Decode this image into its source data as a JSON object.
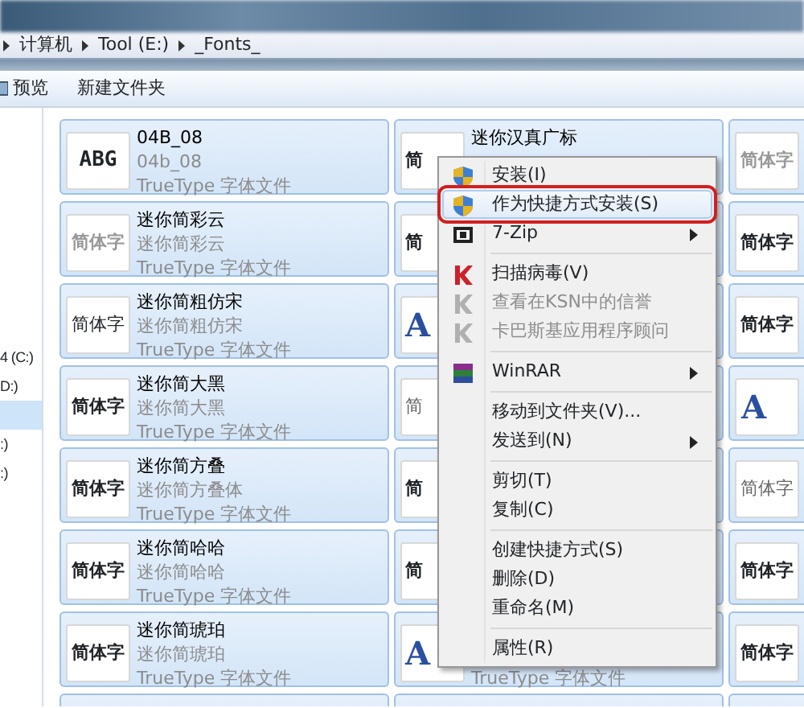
{
  "address_bar": {
    "crumbs": [
      "计算机",
      "Tool (E:)",
      "_Fonts_"
    ]
  },
  "toolbar": {
    "buttons": [
      {
        "label": "预览",
        "kind": "preview"
      },
      {
        "label": "新建文件夹",
        "kind": "plain"
      }
    ]
  },
  "nav_pane": {
    "items": [
      {
        "label": "4 (C:)",
        "selected": false
      },
      {
        "label": "D:)",
        "selected": false
      },
      {
        "selected": true
      },
      {
        "label": ":)",
        "selected": false
      },
      {
        "label": ":)",
        "selected": false
      }
    ]
  },
  "tiles": [
    {
      "selected": true,
      "preview": "ABG",
      "kind": "pixel",
      "name": "04B_08",
      "font": "04b_08",
      "type": "TrueType 字体文件"
    },
    {
      "selected": true,
      "preview": "简",
      "kind": "bold",
      "name": "迷你汉真广标"
    },
    {
      "selected": true,
      "preview": "简体字",
      "kind": "outline"
    },
    {
      "selected": true,
      "preview": "简体字",
      "kind": "outline",
      "name": "迷你简彩云",
      "font": "迷你简彩云",
      "type": "TrueType 字体文件"
    },
    {
      "selected": true,
      "preview": "简",
      "kind": "bold"
    },
    {
      "selected": true,
      "preview": "简体字",
      "kind": "bold"
    },
    {
      "selected": true,
      "preview": "简体字",
      "kind": "regular",
      "name": "迷你简粗仿宋",
      "font": "迷你简粗仿宋",
      "type": "TrueType 字体文件"
    },
    {
      "selected": true,
      "preview": "A",
      "kind": "serif"
    },
    {
      "selected": true,
      "preview": "简体字",
      "kind": "bold"
    },
    {
      "selected": true,
      "preview": "简体字",
      "kind": "bold",
      "name": "迷你简大黑",
      "font": "迷你简大黑",
      "type": "TrueType 字体文件"
    },
    {
      "selected": true,
      "preview": "简",
      "kind": "light"
    },
    {
      "selected": true,
      "preview": "A",
      "kind": "serif"
    },
    {
      "selected": true,
      "preview": "简体字",
      "kind": "bold",
      "name": "迷你简方叠",
      "font": "迷你简方叠体",
      "type": "TrueType 字体文件"
    },
    {
      "selected": true,
      "preview": "简",
      "kind": "bold"
    },
    {
      "selected": true,
      "preview": "简体字",
      "kind": "light"
    },
    {
      "selected": true,
      "preview": "简体字",
      "kind": "bold",
      "name": "迷你简哈哈",
      "font": "迷你简哈哈",
      "type": "TrueType 字体文件"
    },
    {
      "selected": true,
      "preview": "简",
      "kind": "bold"
    },
    {
      "selected": true,
      "preview": "简体字",
      "kind": "bold"
    },
    {
      "selected": true,
      "preview": "简体字",
      "kind": "bold",
      "name": "迷你简琥珀",
      "font": "迷你简琥珀",
      "type": "TrueType 字体文件"
    },
    {
      "selected": true,
      "preview": "A",
      "kind": "serif",
      "type": "TrueType 字体文件"
    },
    {
      "selected": true,
      "preview": "简体字",
      "kind": "bold"
    },
    {
      "selected": true
    },
    {
      "selected": true
    },
    {
      "selected": true
    }
  ],
  "context_menu": {
    "items": [
      {
        "kind": "shield",
        "label": "安装(I)",
        "highlighted": false,
        "annotated": false,
        "disabled": false,
        "submenu": false
      },
      {
        "kind": "shield",
        "label": "作为快捷方式安装(S)",
        "highlighted": true,
        "annotated": true,
        "disabled": false,
        "submenu": false
      },
      {
        "kind": "archive",
        "label": "7-Zip",
        "highlighted": false,
        "annotated": false,
        "disabled": false,
        "submenu": true
      },
      {
        "kind": "separator"
      },
      {
        "kind": "antivirus",
        "label": "扫描病毒(V)",
        "highlighted": false,
        "annotated": false,
        "disabled": false,
        "submenu": false
      },
      {
        "kind": "antivirus",
        "label": "查看在KSN中的信誉",
        "highlighted": false,
        "annotated": false,
        "disabled": true,
        "submenu": false
      },
      {
        "kind": "antivirus",
        "label": "卡巴斯基应用程序顾问",
        "highlighted": false,
        "annotated": false,
        "disabled": true,
        "submenu": false
      },
      {
        "kind": "separator"
      },
      {
        "kind": "books",
        "label": "WinRAR",
        "highlighted": false,
        "annotated": false,
        "disabled": false,
        "submenu": true
      },
      {
        "kind": "separator"
      },
      {
        "kind": "plain",
        "label": "移动到文件夹(V)...",
        "highlighted": false,
        "annotated": false,
        "disabled": false,
        "submenu": false
      },
      {
        "kind": "plain",
        "label": "发送到(N)",
        "highlighted": false,
        "annotated": false,
        "disabled": false,
        "submenu": true
      },
      {
        "kind": "separator"
      },
      {
        "kind": "plain",
        "label": "剪切(T)",
        "highlighted": false,
        "annotated": false,
        "disabled": false,
        "submenu": false
      },
      {
        "kind": "plain",
        "label": "复制(C)",
        "highlighted": false,
        "annotated": false,
        "disabled": false,
        "submenu": false
      },
      {
        "kind": "separator"
      },
      {
        "kind": "plain",
        "label": "创建快捷方式(S)",
        "highlighted": false,
        "annotated": false,
        "disabled": false,
        "submenu": false
      },
      {
        "kind": "plain",
        "label": "删除(D)",
        "highlighted": false,
        "annotated": false,
        "disabled": false,
        "submenu": false
      },
      {
        "kind": "plain",
        "label": "重命名(M)",
        "highlighted": false,
        "annotated": false,
        "disabled": false,
        "submenu": false
      },
      {
        "kind": "separator"
      },
      {
        "kind": "plain",
        "label": "属性(R)",
        "highlighted": false,
        "annotated": false,
        "disabled": false,
        "submenu": false
      }
    ]
  }
}
